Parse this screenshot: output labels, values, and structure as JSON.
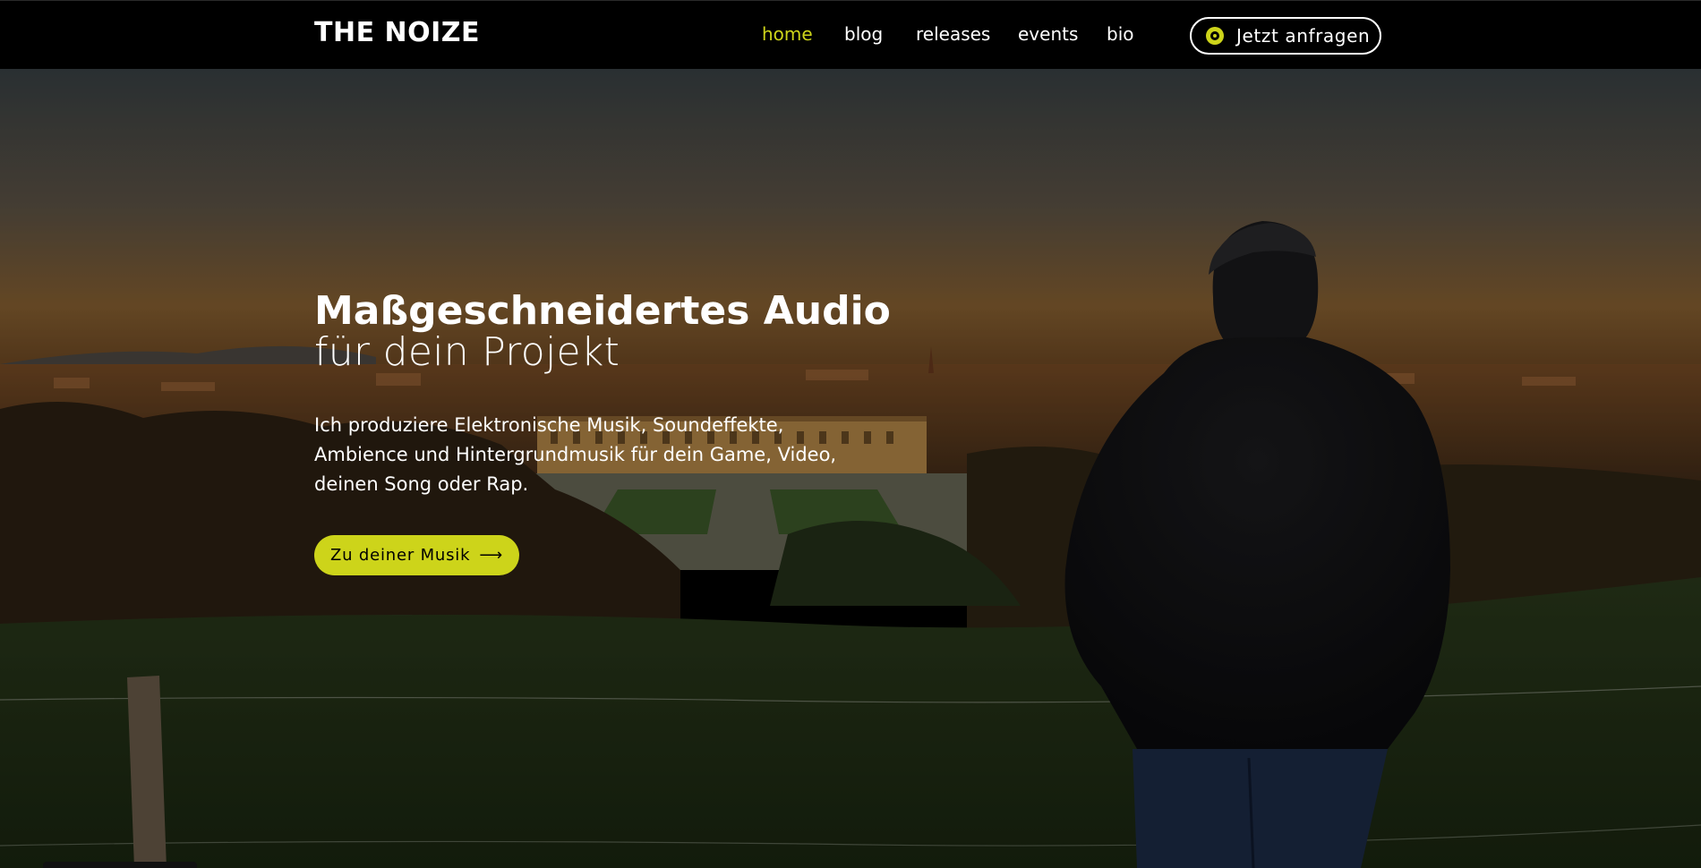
{
  "header": {
    "brand": "THE NOIZE",
    "nav": [
      {
        "label": "home",
        "active": true
      },
      {
        "label": "blog",
        "active": false
      },
      {
        "label": "releases",
        "active": false
      },
      {
        "label": "events",
        "active": false
      },
      {
        "label": "bio",
        "active": false
      }
    ],
    "cta_label": "Jetzt anfragen",
    "cta_icon": "record-icon"
  },
  "hero": {
    "title": "Maßgeschneidertes Audio",
    "subtitle": "für dein Projekt",
    "text": "Ich produziere Elektronische Musik, Soundeffekte, Ambience und Hintergrundmusik für dein Game, Video, deinen Song oder Rap.",
    "button_label": "Zu deiner Musik",
    "button_icon": "arrow-right-icon"
  },
  "colors": {
    "accent": "#cdd41a",
    "nav_background": "#000000",
    "text": "#ffffff"
  }
}
